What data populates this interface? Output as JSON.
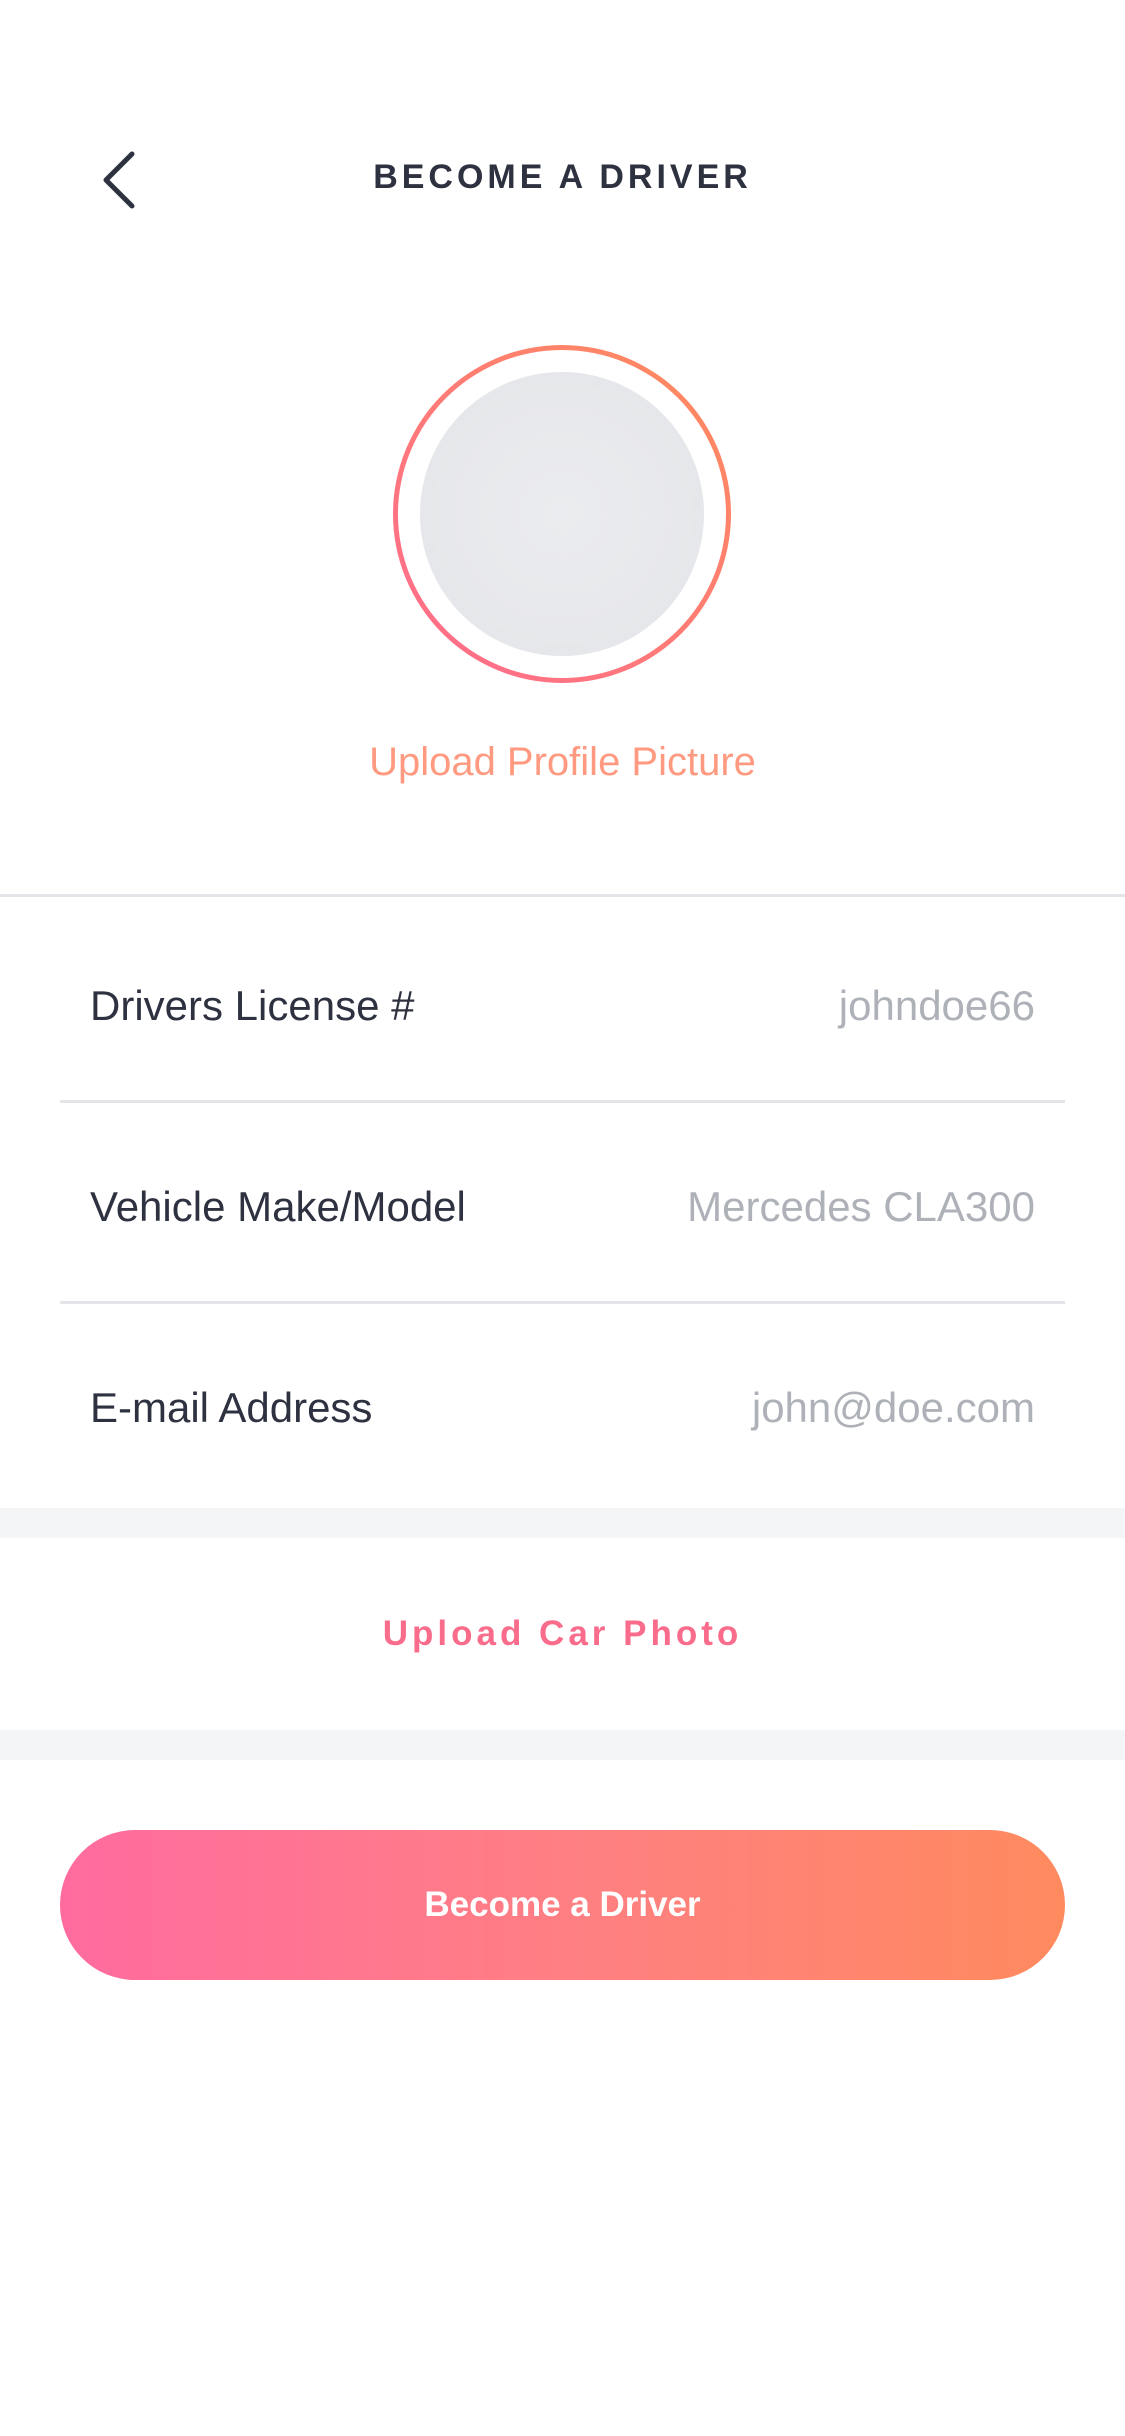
{
  "header": {
    "title": "BECOME A DRIVER",
    "back_icon": "chevron-left-icon"
  },
  "profile": {
    "upload_label": "Upload Profile Picture"
  },
  "form": {
    "rows": [
      {
        "label": "Drivers License #",
        "value": "johndoe66"
      },
      {
        "label": "Vehicle Make/Model",
        "value": "Mercedes CLA300"
      },
      {
        "label": "E-mail Address",
        "value": "john@doe.com"
      }
    ]
  },
  "car_photo": {
    "upload_label": "Upload Car Photo"
  },
  "actions": {
    "submit_label": "Become a Driver"
  },
  "colors": {
    "accent_pink": "#ff6b9f",
    "accent_orange": "#ff8a5e",
    "text_dark": "#2e3140",
    "text_muted": "#aeb1b8"
  }
}
